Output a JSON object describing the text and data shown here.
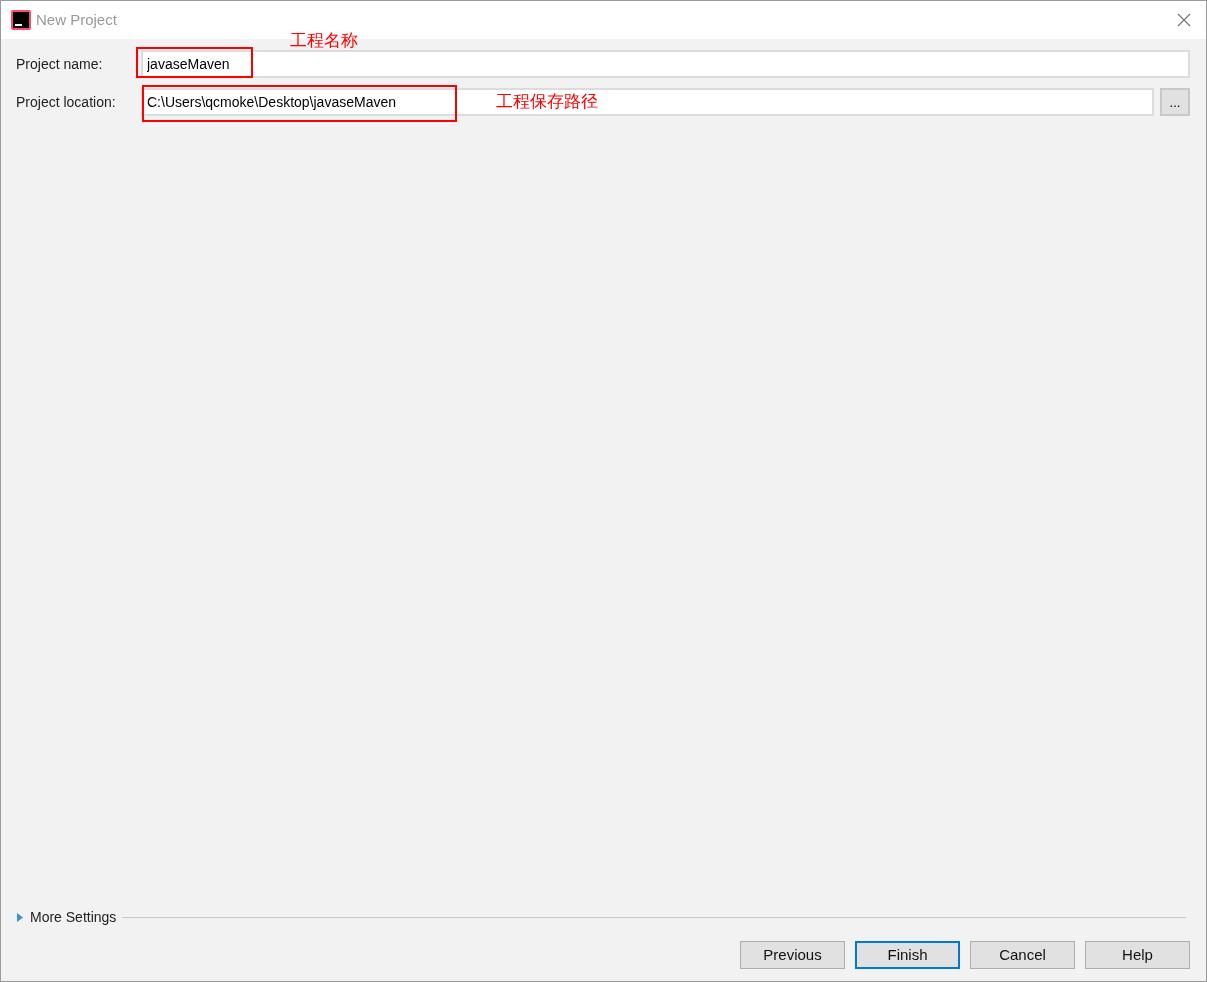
{
  "window": {
    "title": "New Project"
  },
  "fields": [
    {
      "label": "Project name:",
      "value": "javaseMaven"
    },
    {
      "label": "Project location:",
      "value": "C:\\Users\\qcmoke\\Desktop\\javaseMaven",
      "browse_label": "..."
    }
  ],
  "annotations": [
    {
      "text": "工程名称"
    },
    {
      "text": "工程保存路径"
    }
  ],
  "more_settings": {
    "label": "More Settings",
    "expanded": false
  },
  "buttons": [
    {
      "label": "Previous",
      "default": false
    },
    {
      "label": "Finish",
      "default": true
    },
    {
      "label": "Cancel",
      "default": false
    },
    {
      "label": "Help",
      "default": false
    }
  ]
}
